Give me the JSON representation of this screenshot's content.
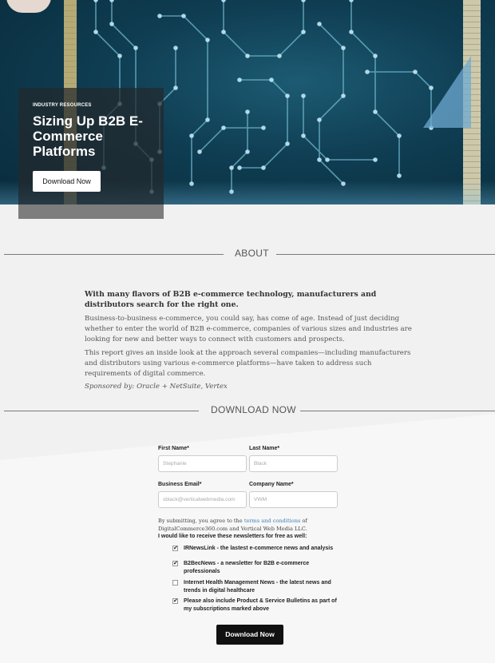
{
  "hero": {
    "tag": "INDUSTRY RESOURCES",
    "title": "Sizing Up B2B E-Commerce Platforms",
    "cta": "Download Now"
  },
  "about": {
    "heading": "ABOUT",
    "lead": "With many flavors of B2B e-commerce technology, manufacturers and distributors search for the right one.",
    "p1": "Business-to-business e-commerce, you could say, has come of age. Instead of just deciding whether to enter the world of B2B e-commerce, companies of various sizes and industries are looking for new and better ways to connect with customers and prospects.",
    "p2": "This report gives an inside look at the approach several companies—including manufacturers and distributors using various e-commerce platforms—have taken to address such requirements of digital commerce.",
    "sponsor": "Sponsored by: Oracle + NetSuite, Vertex"
  },
  "download": {
    "heading": "DOWNLOAD NOW",
    "fields": {
      "first_name_label": "First Name*",
      "first_name_placeholder": "Stephanie",
      "last_name_label": "Last Name*",
      "last_name_placeholder": "Black",
      "email_label": "Business Email*",
      "email_placeholder": "sblack@verticalwebmedia.com",
      "company_label": "Company Name*",
      "company_placeholder": "VWM"
    },
    "terms_before": "By submitting, you agree to the ",
    "terms_link": "terms and conditions",
    "terms_after": " of DigitalCommerce360.com and Vertical Web Media LLC.",
    "newsletters_heading": "I would like to receive these newsletters for free as well:",
    "newsletters": [
      {
        "label": "IRNewsLink - the lastest e-commerce news and analysis",
        "checked": true
      },
      {
        "label": "B2BecNews - a newsletter for B2B e-commerce professionals",
        "checked": true
      },
      {
        "label": "Internet Health Management News - the latest news and trends in digital healthcare",
        "checked": false
      },
      {
        "label": "Please also include Product & Service Bulletins as part of my subscriptions marked above",
        "checked": true
      }
    ],
    "submit": "Download Now"
  },
  "colors": {
    "hero_bg": "#0f3d52",
    "circuit": "#7ec3d8",
    "button_dark": "#111111",
    "link": "#3d7fb5"
  }
}
